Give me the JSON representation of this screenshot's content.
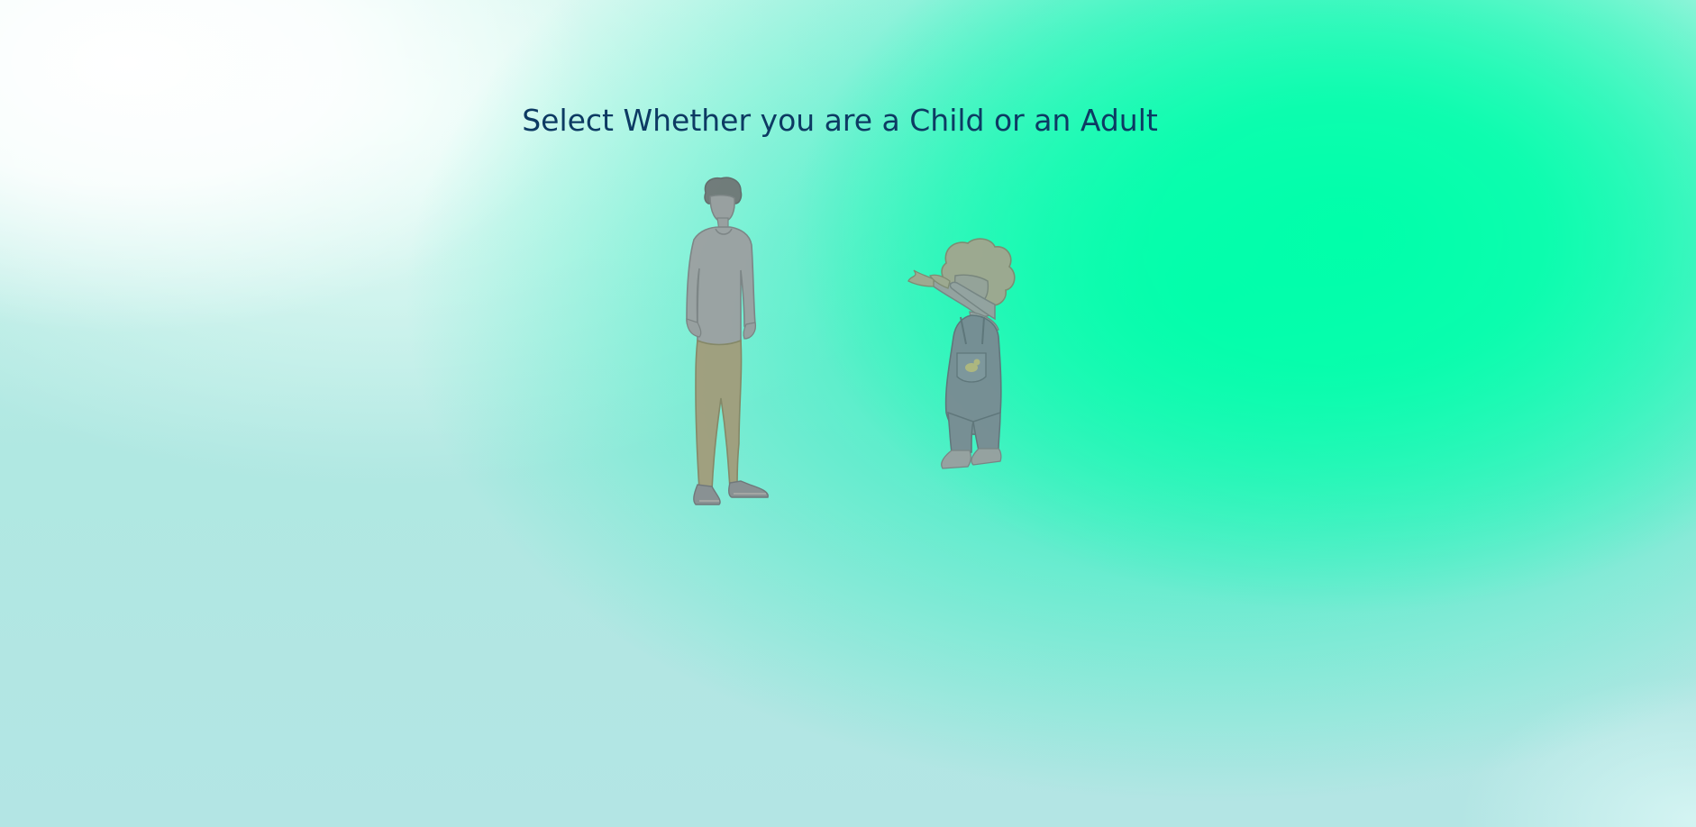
{
  "page": {
    "title": "Select Whether you are a Child or an Adult"
  },
  "options": {
    "adult": {
      "icon": "adult-figure-icon"
    },
    "child": {
      "icon": "child-figure-icon"
    }
  },
  "colors": {
    "title": "#0d3a63",
    "background_green": "#00ffaa",
    "background_light": "#b2e6e4",
    "figure_gray": "#9c9c9e",
    "figure_pants_tan": "#a59a78",
    "figure_overalls": "#7b8790"
  }
}
